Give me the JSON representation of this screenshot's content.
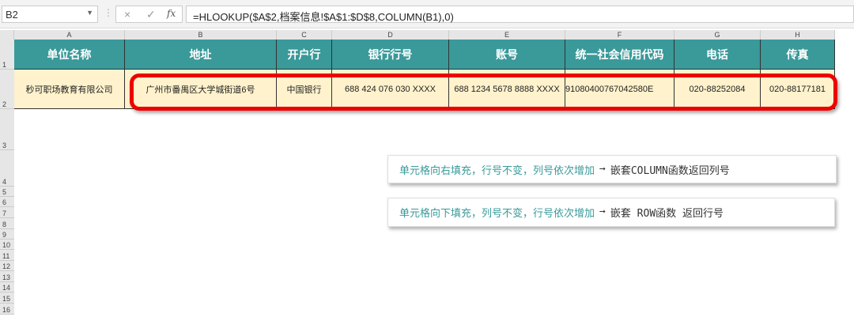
{
  "name_box": "B2",
  "formula": "=HLOOKUP($A$2,档案信息!$A$1:$D$8,COLUMN(B1),0)",
  "icons": {
    "cancel": "×",
    "enter": "✓",
    "fx": "fx"
  },
  "columns": [
    "A",
    "B",
    "C",
    "D",
    "E",
    "F",
    "G",
    "H"
  ],
  "rows": [
    "1",
    "2",
    "3",
    "4",
    "5",
    "6",
    "7",
    "8",
    "9",
    "10",
    "11",
    "12",
    "13",
    "14",
    "15",
    "16"
  ],
  "headers": [
    "单位名称",
    "地址",
    "开户行",
    "银行行号",
    "账号",
    "统一社会信用代码",
    "电话",
    "传真"
  ],
  "values": [
    "秒可职场教育有限公司",
    "广州市番禺区大学城街道6号",
    "中国银行",
    "688 424 076 030 XXXX",
    "688 1234 5678 8888 XXXX",
    "91080400767042580E",
    "020-88252084",
    "020-88177181"
  ],
  "notes": [
    {
      "text": "单元格向右填充，行号不变，列号依次增加",
      "arrow": "➞",
      "result": "嵌套COLUMN函数返回列号"
    },
    {
      "text": "单元格向下填充，列号不变，行号依次增加",
      "arrow": "➞",
      "result": "嵌套 ROW函数 返回行号"
    }
  ],
  "colors": {
    "header": "#3a9999",
    "data_row": "#fff2cc",
    "highlight": "#ee0000"
  }
}
